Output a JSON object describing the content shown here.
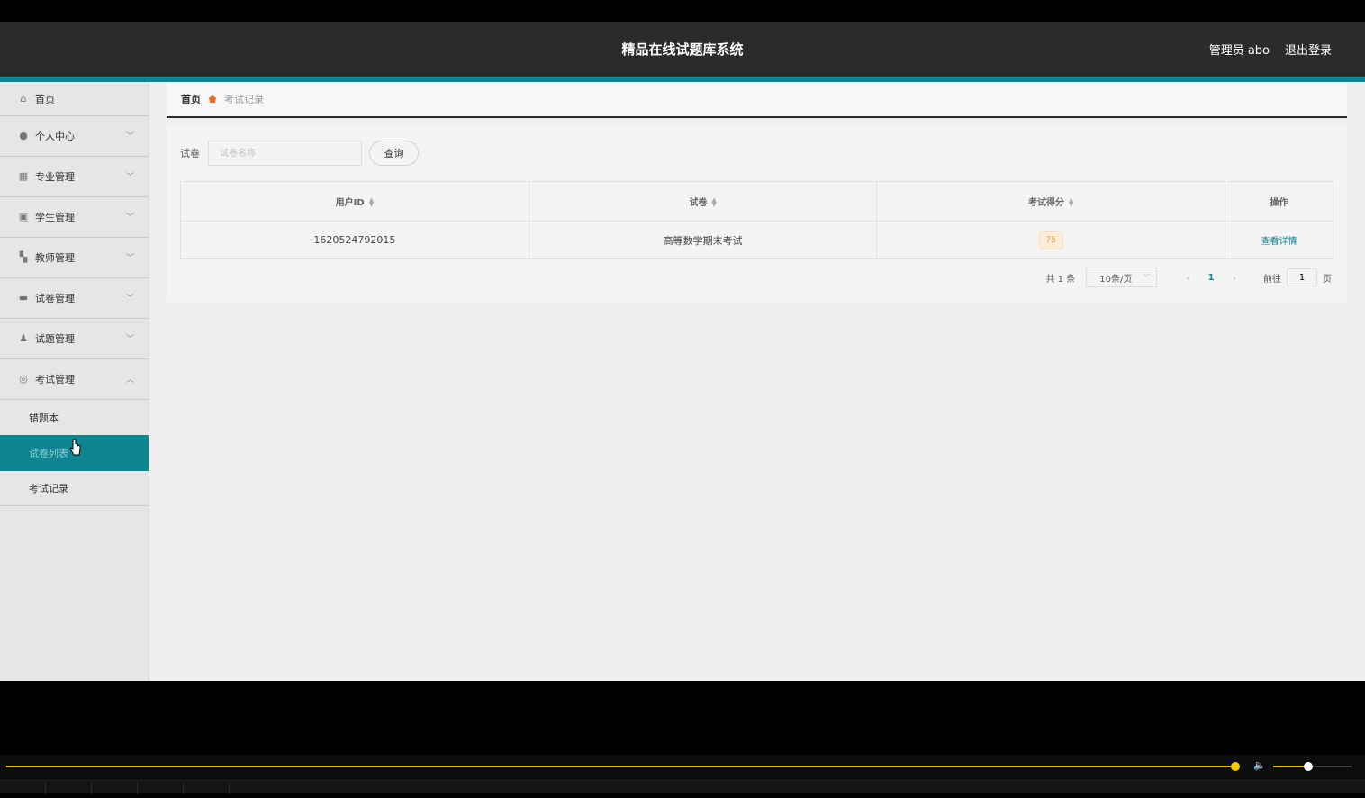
{
  "header": {
    "title": "精品在线试题库系统",
    "user": "管理员 abo",
    "logout": "退出登录"
  },
  "sidebar": {
    "items": [
      {
        "label": "首页",
        "icon": "home-icon"
      },
      {
        "label": "个人中心",
        "icon": "user-icon"
      },
      {
        "label": "专业管理",
        "icon": "grid-icon"
      },
      {
        "label": "学生管理",
        "icon": "clipboard-icon"
      },
      {
        "label": "教师管理",
        "icon": "apps-icon"
      },
      {
        "label": "试卷管理",
        "icon": "monitor-icon"
      },
      {
        "label": "试题管理",
        "icon": "person-icon"
      },
      {
        "label": "考试管理",
        "icon": "target-icon"
      }
    ],
    "sub_items": [
      {
        "label": "错题本"
      },
      {
        "label": "试卷列表"
      },
      {
        "label": "考试记录"
      }
    ]
  },
  "breadcrumb": {
    "home": "首页",
    "current": "考试记录"
  },
  "search": {
    "label": "试卷",
    "placeholder": "试卷名称",
    "button": "查询"
  },
  "table": {
    "columns": [
      "用户ID",
      "试卷",
      "考试得分",
      "操作"
    ],
    "rows": [
      {
        "user_id": "1620524792015",
        "paper": "高等数学期末考试",
        "score": "75",
        "action": "查看详情"
      }
    ]
  },
  "pagination": {
    "total": "共 1 条",
    "page_size": "10条/页",
    "current_page": "1",
    "goto_label": "前往",
    "goto_value": "1",
    "page_suffix": "页"
  },
  "colors": {
    "accent": "#0e8592",
    "header_bg": "#2b2b2b",
    "breadcrumb_icon": "#f06b22",
    "score_tag": "#e6a23c",
    "video_progress": "#e8c300"
  }
}
